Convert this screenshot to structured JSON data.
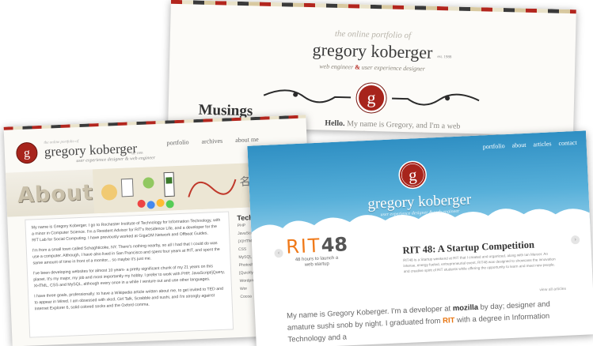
{
  "portfolio_back": {
    "tagline": "the online portfolio of",
    "name": "gregory koberger",
    "since": "est. 1988",
    "subtitle_part1": "web engineer",
    "subtitle_amp": "&",
    "subtitle_part2": "user experience designer",
    "heading": "Musings",
    "hello_bold": "Hello.",
    "hello_text": " My name is Gregory, and I'm a web engineer and user experience designer. I"
  },
  "portfolio_about": {
    "tagline": "the online portfolio of",
    "name": "gregory koberger",
    "since": "est. 1988",
    "subtitle": "user experience designer & web engineer",
    "nav": [
      "portfolio",
      "archives",
      "about me"
    ],
    "page_title": "About",
    "paragraphs": [
      "My name is Gregory Koberger. I go to Rochester Institute of Technology for Information Technology, with a minor in Computer Science. I'm a Resident Advisor for RIT's Residence Life, and a developer for the RIT Lab for Social Computing. I have previously worked at GigaOM Network and Offbeat Guides.",
      "I'm from a small town called Schaghticoke, NY. There's nothing nearby, so all I had that I could do was use a computer. Although, I have also lived in San Francisco and spent four years at RIT, and spent the same amount of time in front of a monitor... so maybe it's just me.",
      "I've been developing websites for almost 10 years- a pretty significant chunk of my 21 years on this planet. It's my major, my job and most importantly my hobby. I prefer to work with PHP, JavaScript/jQuery, XHTML, CSS and MySQL, although every once in a while I venture out and use other languages.",
      "I have three goals, professionally: to have a Wikipedia article written about me, to get invited to TED and to appear in Wired. I am obsessed with xkcd, Girl Talk, Scrabble and sushi, and I'm strongly against Internet Explorer 6, solid colored socks and the Oxford comma."
    ],
    "side_heading": "Techn",
    "side_items": [
      "PHP",
      "JavaScript",
      "(X)HTML",
      "CSS",
      "MySQL",
      "Photoshop",
      "[Quickly]",
      "Wordpress",
      "Wor",
      "Cocoa"
    ]
  },
  "portfolio_front": {
    "nav": [
      "portfolio",
      "about",
      "articles",
      "contact"
    ],
    "name": "gregory koberger",
    "subtitle": "user experience designer & web engineer",
    "prev_arrow": "‹",
    "next_arrow": "›",
    "rit_letters": "RIT",
    "rit_number": "48",
    "rit_caption": "48 hours to launch a web startup",
    "feature_title": "RIT 48: A Startup Competition",
    "feature_desc": "RIT48 is a Startup weekend at RIT that I created and organized, along with Ian Mercer. An intense, energy fueled, entrepreneurial event, RIT48 was designed to showcase the innovation and creative spirit of RIT students while offering the opportunity to learn and meet new people.",
    "view_all": "view all articles",
    "bio_1": "My name is Gregory Koberger.  I'm a developer at ",
    "bio_mozilla": "mozilla",
    "bio_2": " by day; designer and amature sushi snob by night.  I graduated from ",
    "bio_rit": "RIT",
    "bio_3": " with a degree in Information Technology and a"
  },
  "colors": {
    "brand_red": "#b3261e",
    "sky_blue": "#3c9acb",
    "rit_orange": "#f07a1a"
  }
}
